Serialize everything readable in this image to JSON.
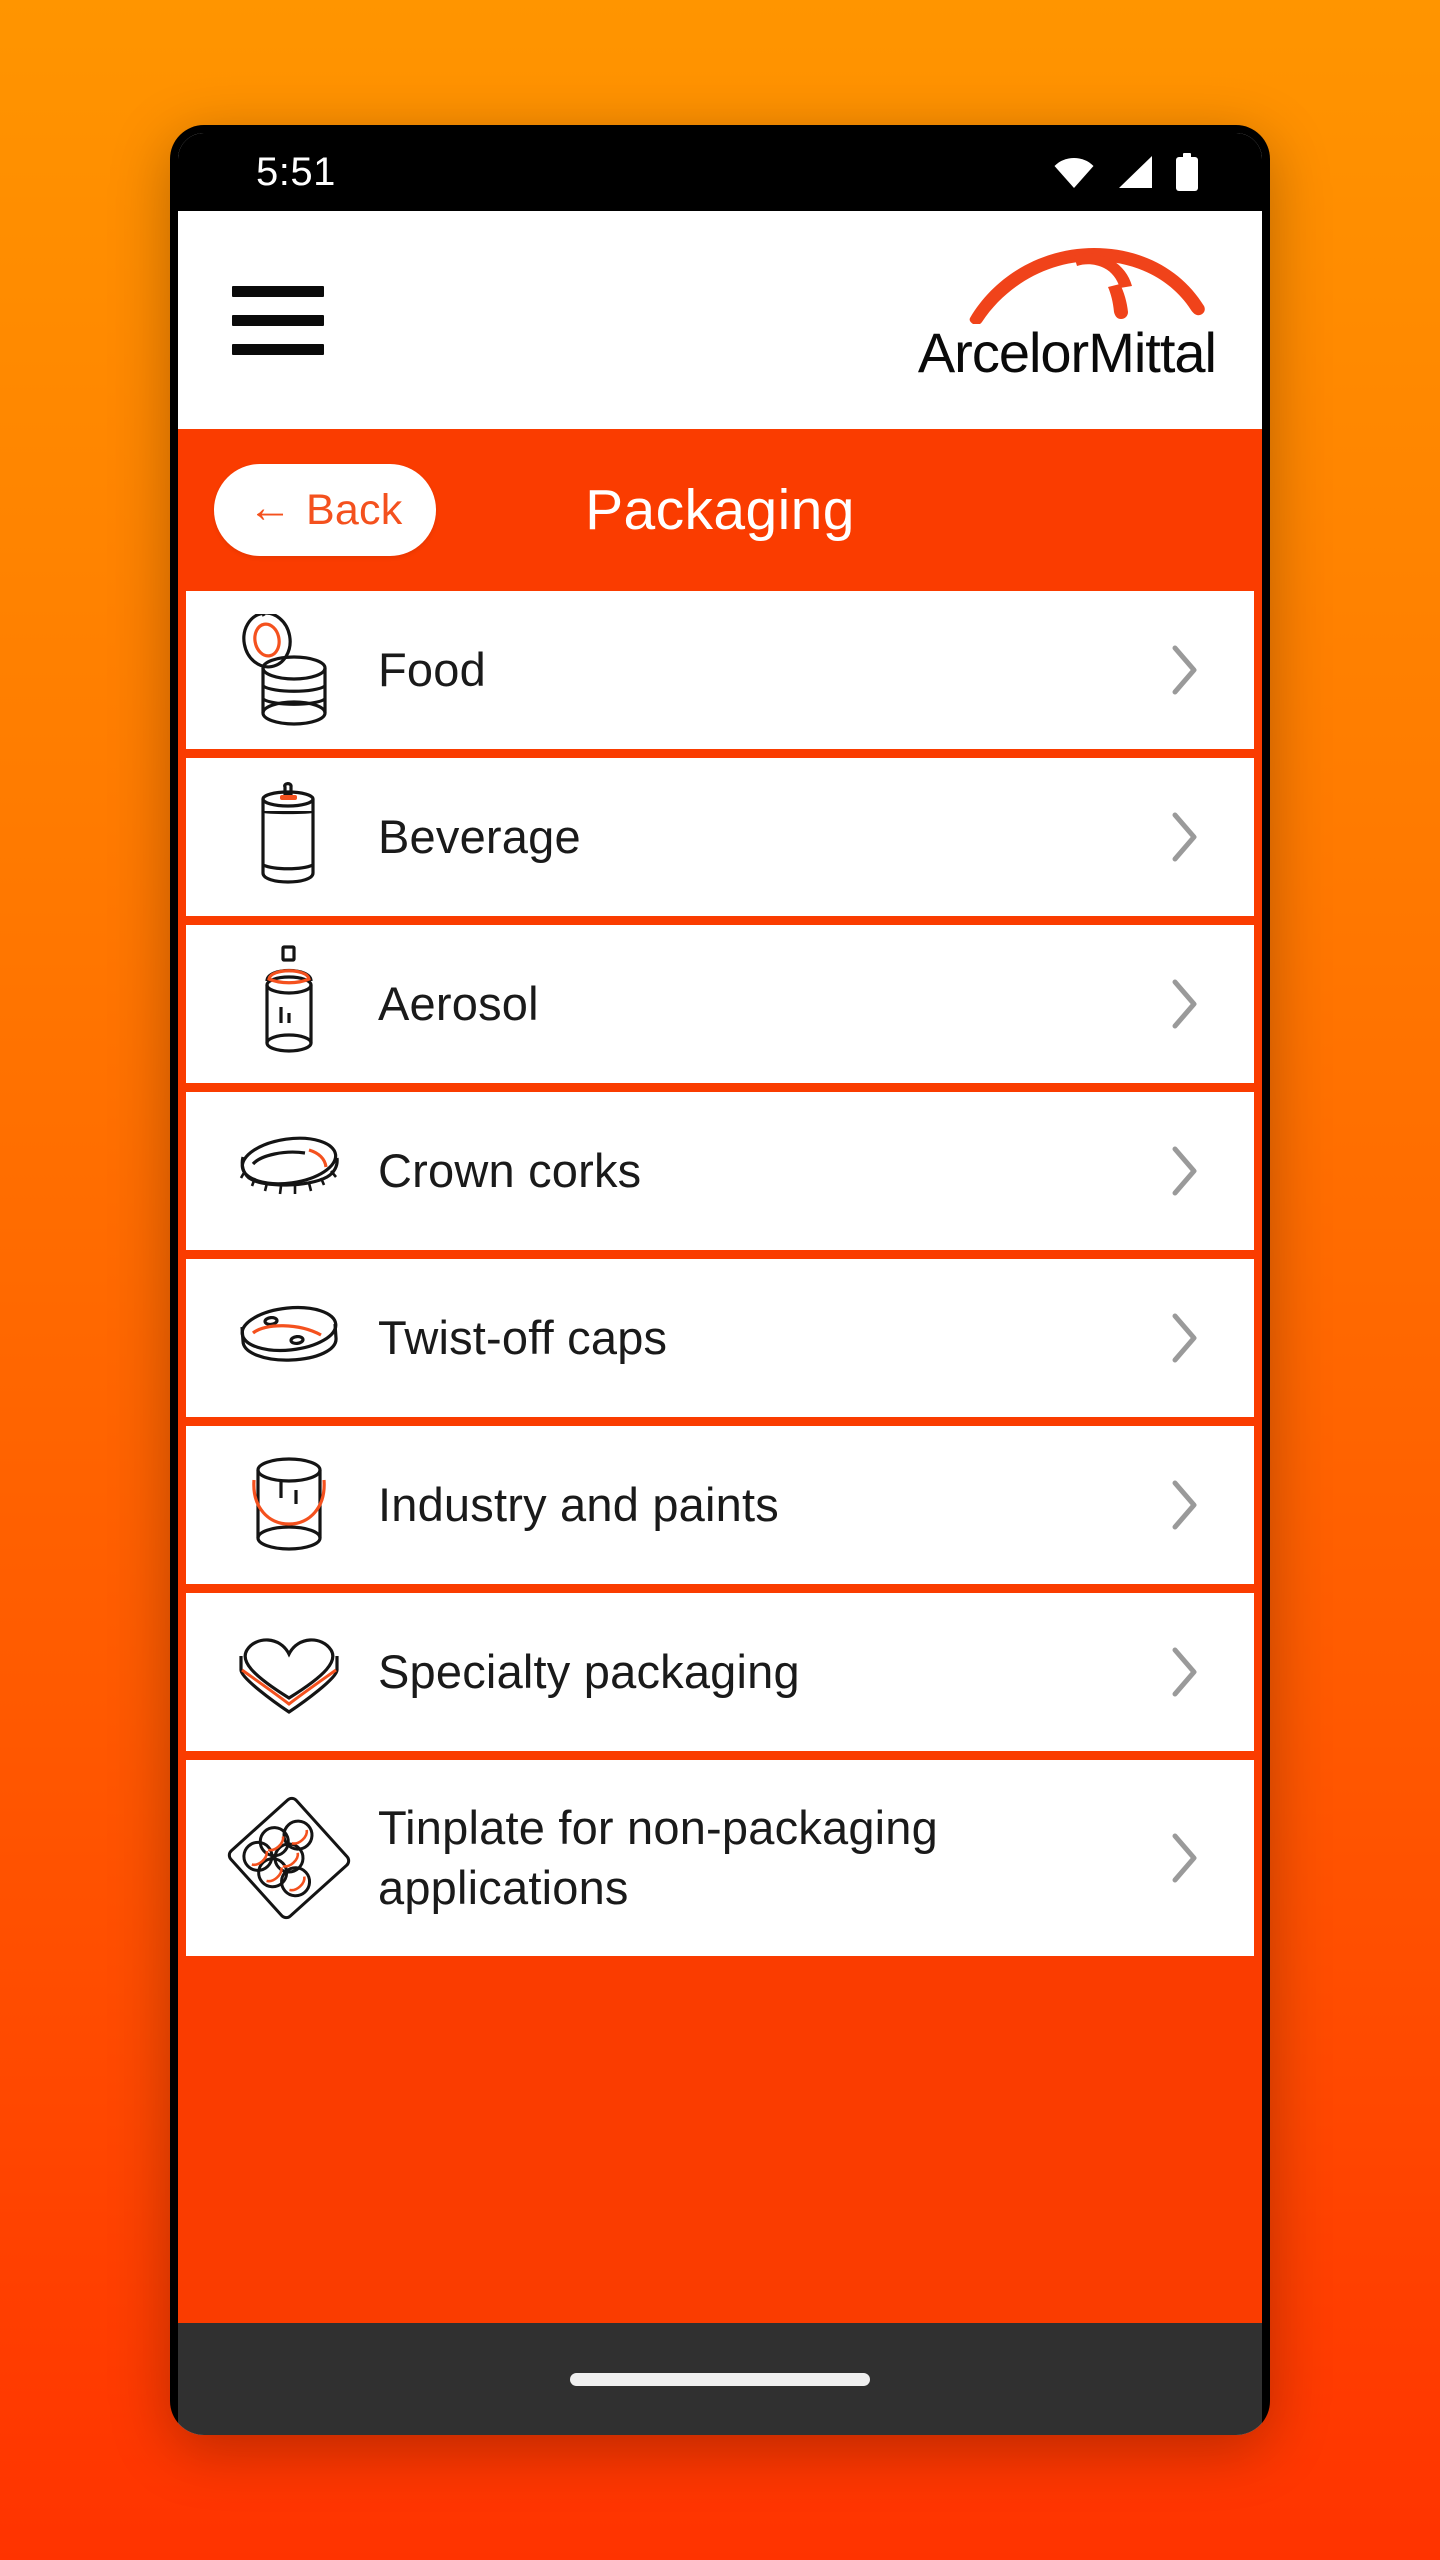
{
  "status_bar": {
    "time": "5:51",
    "icons": [
      "wifi-icon",
      "cellular-signal-icon",
      "battery-icon"
    ]
  },
  "app_bar": {
    "menu_icon": "hamburger-menu-icon",
    "logo_text": "ArcelorMittal",
    "logo_mark": "arcelormittal-swoosh-icon"
  },
  "header": {
    "back_arrow": "←",
    "back_label": "Back",
    "title": "Packaging"
  },
  "list": {
    "items": [
      {
        "label": "Food",
        "icon": "food-can-icon",
        "chevron": "chevron-right-icon"
      },
      {
        "label": "Beverage",
        "icon": "beverage-can-icon",
        "chevron": "chevron-right-icon"
      },
      {
        "label": "Aerosol",
        "icon": "aerosol-can-icon",
        "chevron": "chevron-right-icon"
      },
      {
        "label": "Crown corks",
        "icon": "crown-cork-icon",
        "chevron": "chevron-right-icon"
      },
      {
        "label": "Twist-off caps",
        "icon": "twist-off-cap-icon",
        "chevron": "chevron-right-icon"
      },
      {
        "label": "Industry and paints",
        "icon": "paint-bucket-icon",
        "chevron": "chevron-right-icon"
      },
      {
        "label": "Specialty packaging",
        "icon": "heart-tin-icon",
        "chevron": "chevron-right-icon"
      },
      {
        "label": "Tinplate for non-packaging applications",
        "icon": "tinplate-tray-icon",
        "chevron": "chevron-right-icon"
      }
    ]
  },
  "nav_bar": {
    "home_indicator": "home-indicator"
  },
  "colors": {
    "brand_red": "#fa3c00",
    "brand_orange": "#f4511e",
    "background_top": "#ff9500",
    "background_bottom": "#ff3300",
    "status_bar": "#000000",
    "nav_bar": "#303030",
    "text_primary": "#1a1a1a",
    "chevron_gray": "#9a9a9a"
  }
}
